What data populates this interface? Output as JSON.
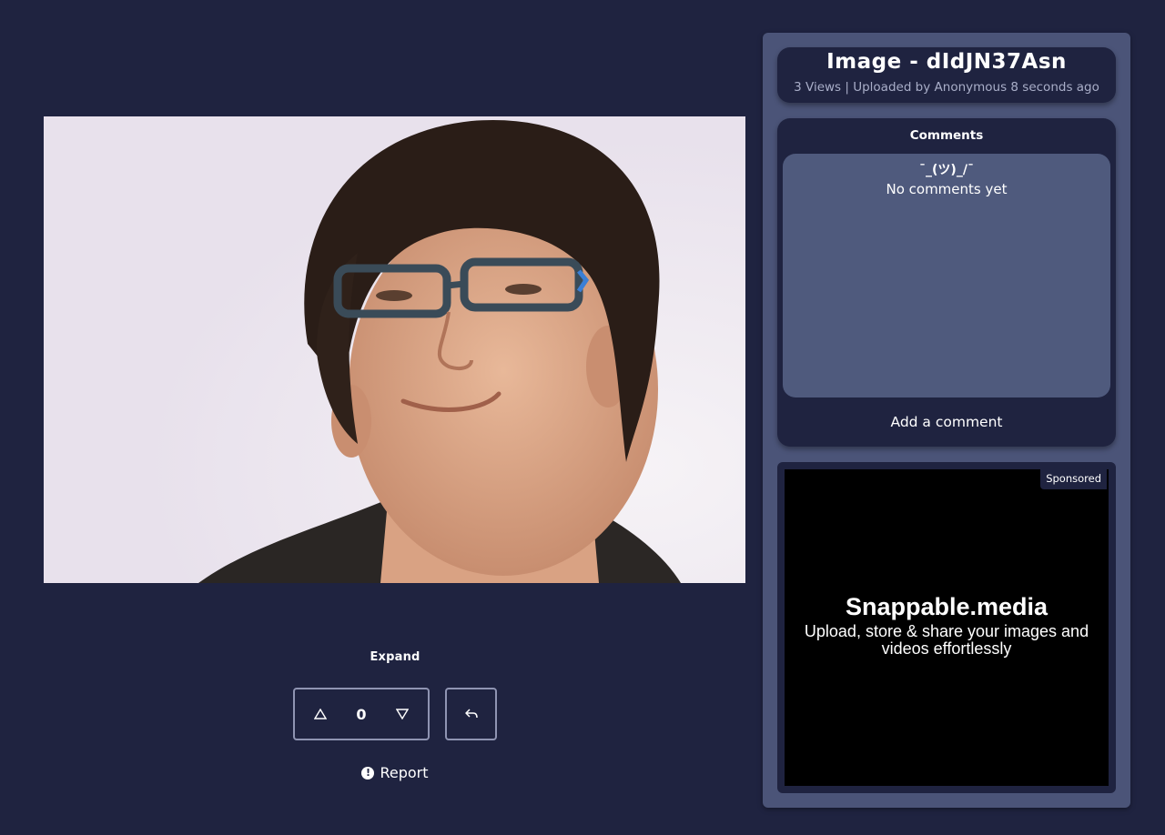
{
  "image": {
    "alt": "Uploaded photo"
  },
  "controls": {
    "expand_label": "Expand",
    "vote_count": "0",
    "report_label": "Report"
  },
  "info": {
    "title": "Image - dIdJN37Asn",
    "meta": "3 Views | Uploaded by Anonymous 8 seconds ago"
  },
  "comments": {
    "heading": "Comments",
    "shrug": "¯_(ツ)_/¯",
    "empty_text": "No comments yet",
    "add_label": "Add a comment"
  },
  "ad": {
    "badge": "Sponsored",
    "title": "Snappable.media",
    "subtitle": "Upload, store & share your images and videos effortlessly"
  },
  "colors": {
    "page_bg": "#1f2340",
    "sidebar_bg": "#4b5478",
    "comments_list_bg": "#4f5a7d",
    "ad_bg": "#000000"
  }
}
